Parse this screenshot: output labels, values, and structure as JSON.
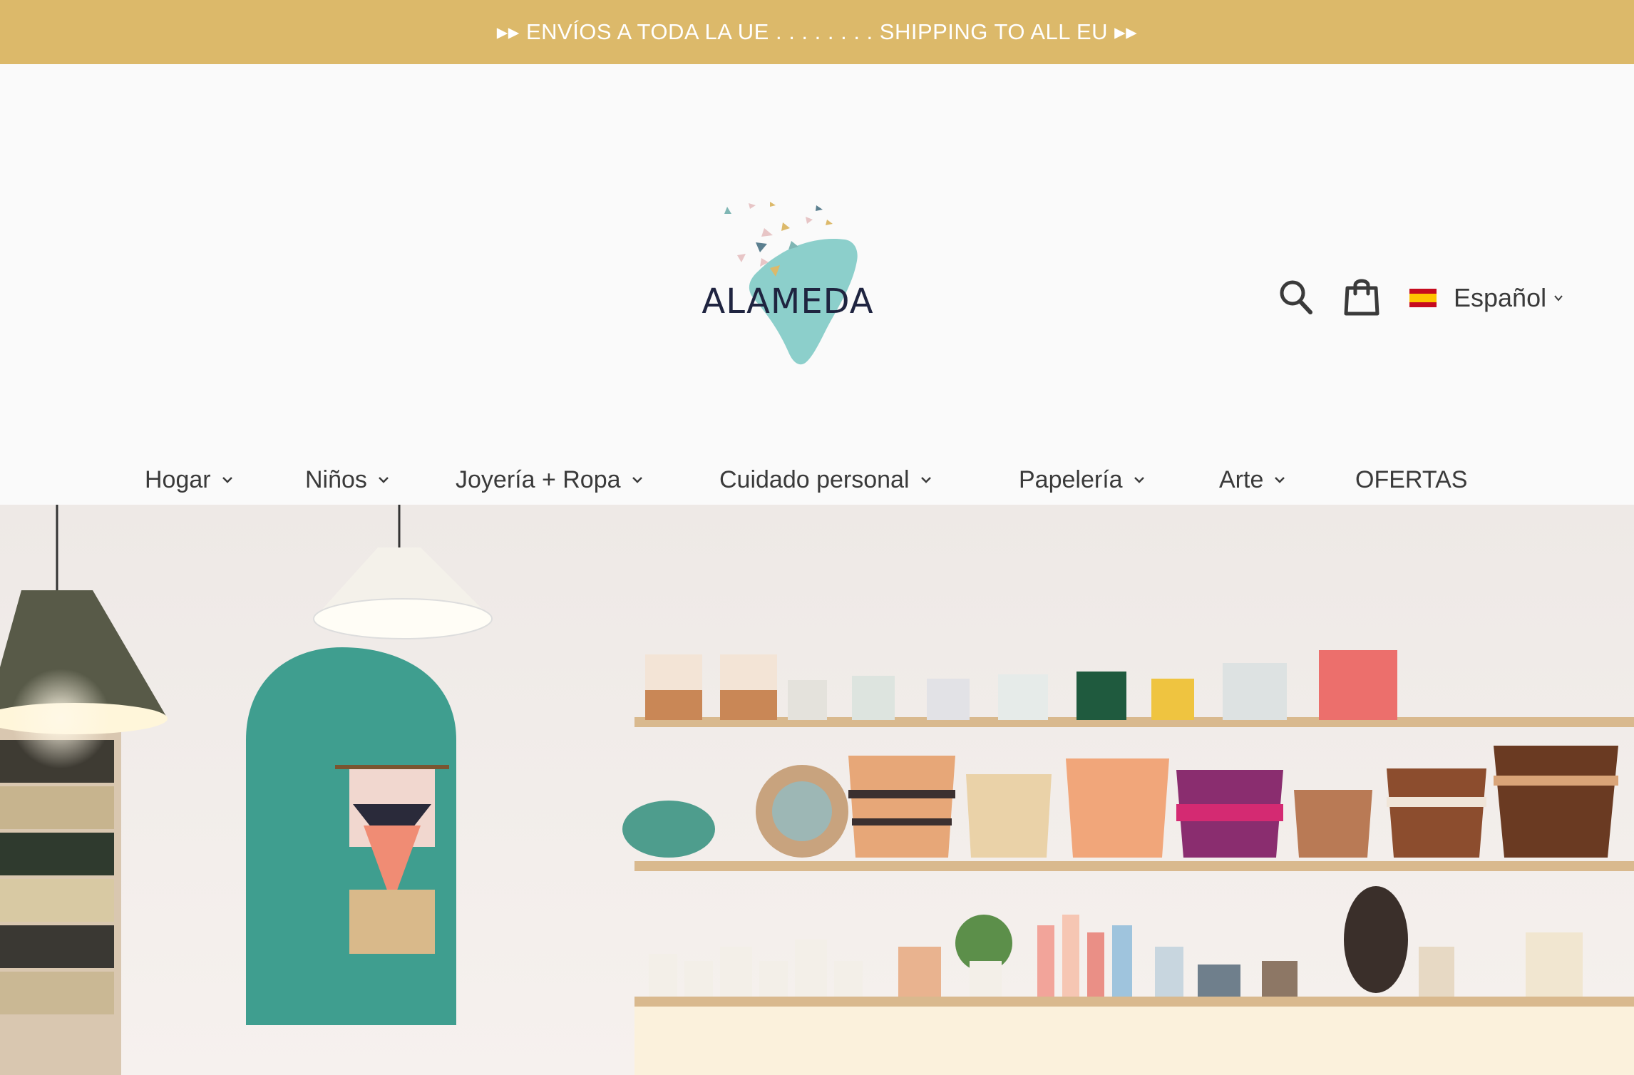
{
  "announcement": {
    "text": "▸▸ ENVÍOS A TODA LA UE . . . . . . . . SHIPPING TO ALL EU ▸▸"
  },
  "brand": {
    "logo_text": "ALAMEDA",
    "accent_color": "#8ccfcb",
    "bar_color": "#dcb96a"
  },
  "header": {
    "search_icon": "search-icon",
    "cart_icon": "shopping-bag-icon"
  },
  "language": {
    "selected": "Español",
    "flag_icon": "spain-flag-icon"
  },
  "nav": {
    "items": [
      {
        "label": "Hogar",
        "has_dropdown": true
      },
      {
        "label": "Niños",
        "has_dropdown": true
      },
      {
        "label": "Joyería + Ropa",
        "has_dropdown": true
      },
      {
        "label": "Cuidado personal",
        "has_dropdown": true
      },
      {
        "label": "Papelería",
        "has_dropdown": true
      },
      {
        "label": "Arte",
        "has_dropdown": true
      },
      {
        "label": "OFERTAS",
        "has_dropdown": false
      }
    ]
  }
}
